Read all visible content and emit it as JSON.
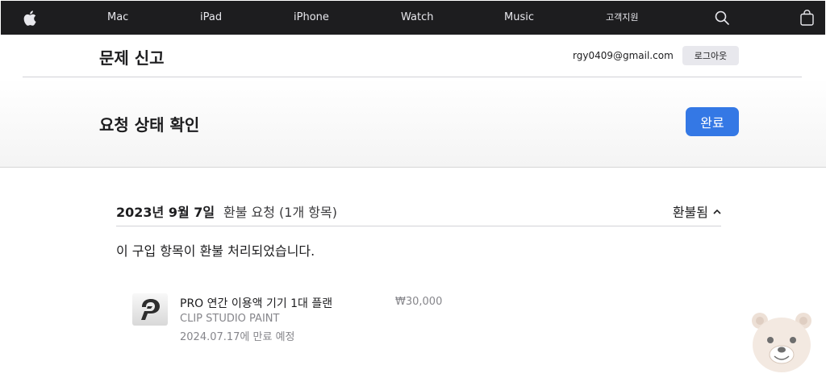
{
  "nav": {
    "items": [
      {
        "label": "Mac"
      },
      {
        "label": "iPad"
      },
      {
        "label": "iPhone"
      },
      {
        "label": "Watch"
      },
      {
        "label": "Music"
      },
      {
        "label": "고객지원"
      }
    ],
    "icons": {
      "logo": "apple-logo-icon",
      "search": "search-icon",
      "bag": "shopping-bag-icon"
    }
  },
  "header": {
    "title": "문제 신고",
    "email": "rgy0409@gmail.com",
    "logout_label": "로그아웃"
  },
  "status": {
    "title": "요청 상태 확인",
    "done_label": "완료",
    "accent": "#3478e5"
  },
  "order": {
    "date": "2023년 9월 7일",
    "type": "환불 요청 (1개 항목)",
    "status_label": "환불됨",
    "message": "이 구입 항목이 환불 처리되었습니다.",
    "items": [
      {
        "name": "PRO 연간 이용액 기기 1대 플랜",
        "price": "₩30,000",
        "developer": "CLIP STUDIO PAINT",
        "expiry": "2024.07.17에 만료 예정",
        "icon": "clip-studio-app-icon"
      }
    ]
  }
}
